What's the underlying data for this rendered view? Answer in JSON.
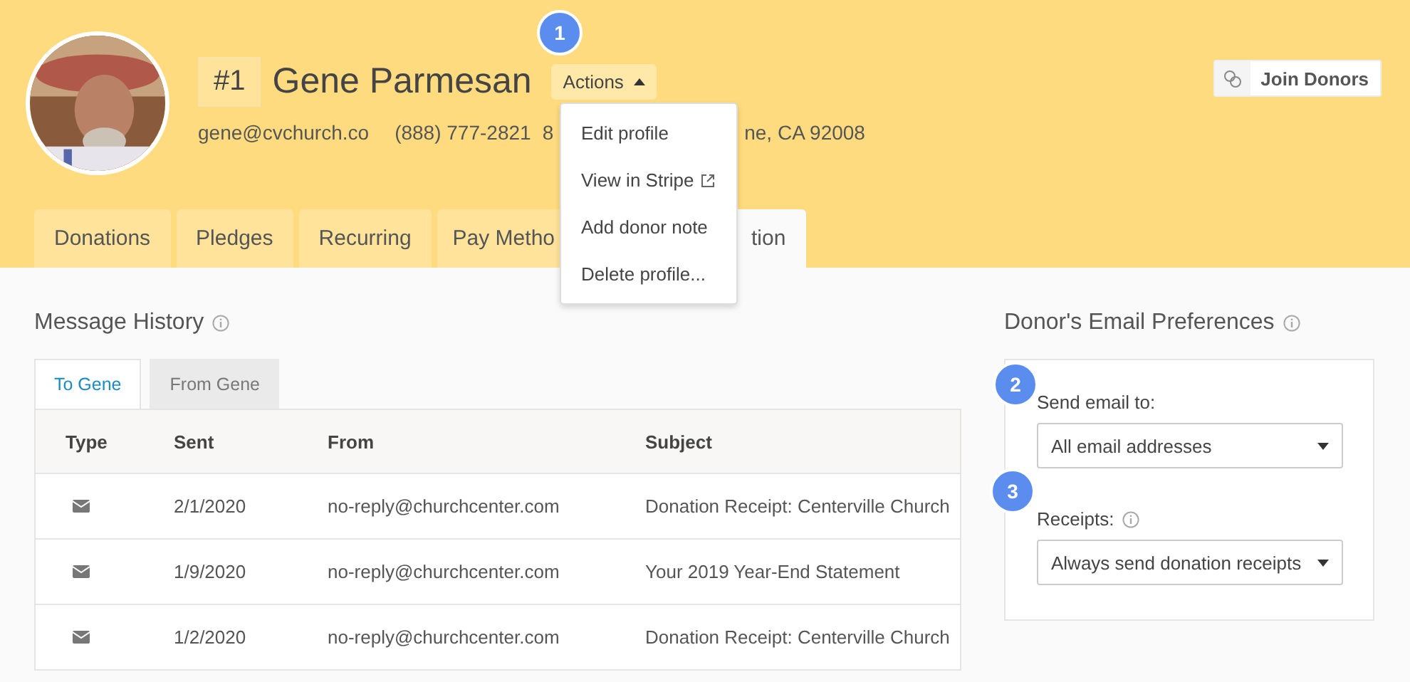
{
  "profile": {
    "number": "#1",
    "name": "Gene Parmesan",
    "email": "gene@cvchurch.co",
    "phone": "(888) 777-2821",
    "address_start": "8",
    "address_end": "ne, CA 92008"
  },
  "actions_button": {
    "label": "Actions",
    "expanded": true
  },
  "actions_menu": [
    {
      "label": "Edit profile",
      "external": false
    },
    {
      "label": "View in Stripe",
      "external": true
    },
    {
      "label": "Add donor note",
      "external": false
    },
    {
      "label": "Delete profile...",
      "external": false
    }
  ],
  "join_button": {
    "label": "Join Donors"
  },
  "tabs": [
    {
      "label": "Donations",
      "selected": false
    },
    {
      "label": "Pledges",
      "selected": false
    },
    {
      "label": "Recurring",
      "selected": false
    },
    {
      "label": "Pay Metho",
      "selected": false
    },
    {
      "label": "tion",
      "selected": true
    }
  ],
  "message_history": {
    "title": "Message History",
    "tabs": [
      {
        "label": "To Gene",
        "selected": true
      },
      {
        "label": "From Gene",
        "selected": false
      }
    ],
    "columns": [
      "Type",
      "Sent",
      "From",
      "Subject"
    ],
    "rows": [
      {
        "sent": "2/1/2020",
        "from": "no-reply@churchcenter.com",
        "subject": "Donation Receipt: Centerville Church"
      },
      {
        "sent": "1/9/2020",
        "from": "no-reply@churchcenter.com",
        "subject": "Your 2019 Year-End Statement"
      },
      {
        "sent": "1/2/2020",
        "from": "no-reply@churchcenter.com",
        "subject": "Donation Receipt: Centerville Church"
      }
    ]
  },
  "email_preferences": {
    "title": "Donor's Email Preferences",
    "fields": [
      {
        "label": "Send email to:",
        "value": "All email addresses",
        "info": false,
        "step": "2"
      },
      {
        "label": "Receipts:",
        "value": "Always send donation receipts",
        "info": true,
        "step": "3"
      }
    ]
  },
  "steps": [
    {
      "label": "1"
    }
  ]
}
